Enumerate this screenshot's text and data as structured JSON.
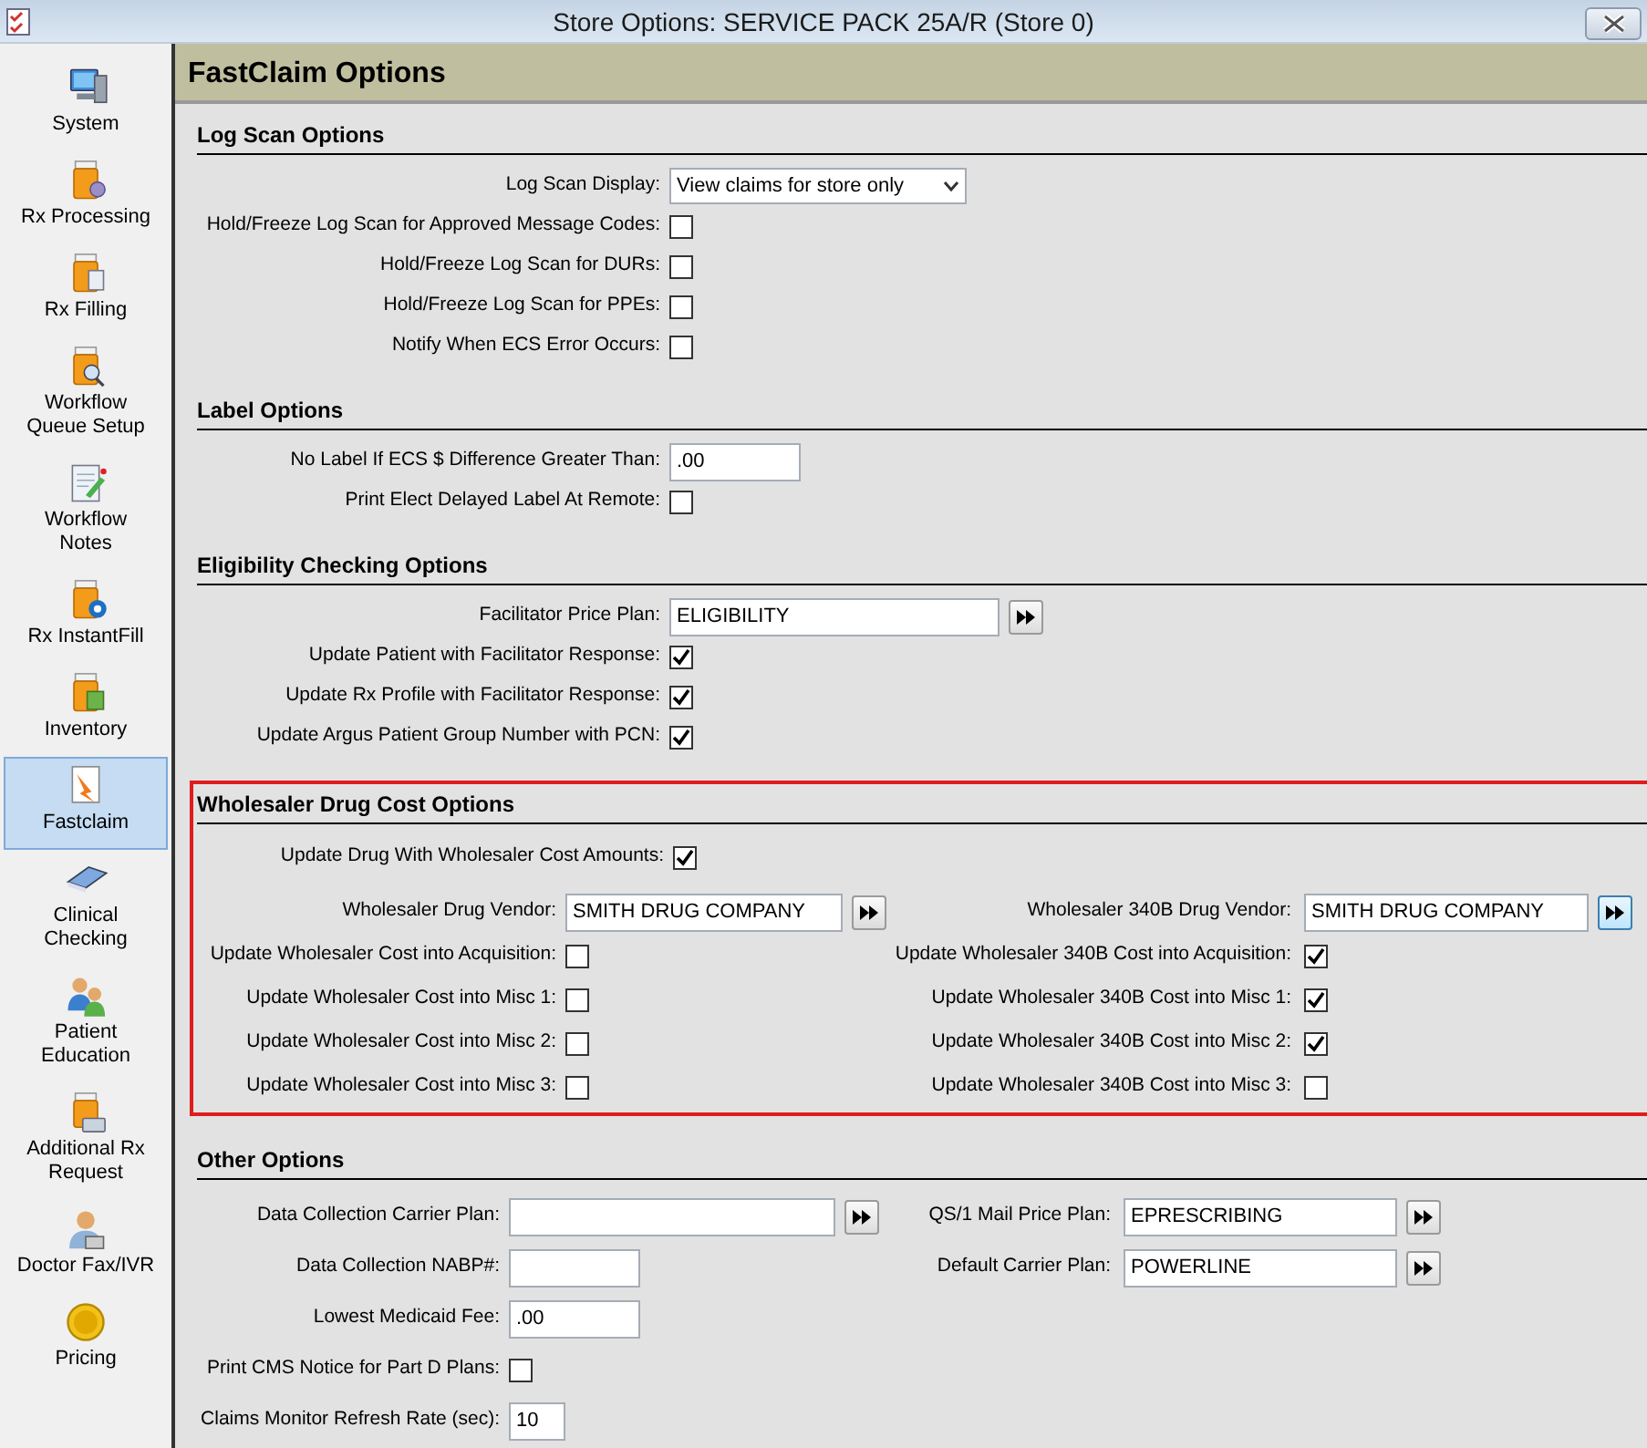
{
  "window": {
    "title": "Store Options: SERVICE PACK 25A/R (Store 0)"
  },
  "sidebar": {
    "items": [
      {
        "label": "System",
        "selected": false
      },
      {
        "label": "Rx Processing",
        "selected": false
      },
      {
        "label": "Rx Filling",
        "selected": false
      },
      {
        "label": "Workflow\nQueue Setup",
        "selected": false
      },
      {
        "label": "Workflow\nNotes",
        "selected": false
      },
      {
        "label": "Rx InstantFill",
        "selected": false
      },
      {
        "label": "Inventory",
        "selected": false
      },
      {
        "label": "Fastclaim",
        "selected": true
      },
      {
        "label": "Clinical\nChecking",
        "selected": false
      },
      {
        "label": "Patient\nEducation",
        "selected": false
      },
      {
        "label": "Additional Rx\nRequest",
        "selected": false
      },
      {
        "label": "Doctor Fax/IVR",
        "selected": false
      },
      {
        "label": "Pricing",
        "selected": false
      }
    ]
  },
  "page_title": "FastClaim Options",
  "sections": [
    {
      "title": "Log Scan Options",
      "highlighted": false,
      "rows": [
        [
          {
            "kind": "select",
            "label": "Log Scan Display:",
            "value": "View claims for store only"
          }
        ],
        [
          {
            "kind": "checkbox",
            "label": "Hold/Freeze Log Scan for Approved Message Codes:",
            "checked": false
          }
        ],
        [
          {
            "kind": "checkbox",
            "label": "Hold/Freeze Log Scan for DURs:",
            "checked": false
          }
        ],
        [
          {
            "kind": "checkbox",
            "label": "Hold/Freeze Log Scan for PPEs:",
            "checked": false
          }
        ],
        [
          {
            "kind": "checkbox",
            "label": "Notify When ECS Error Occurs:",
            "checked": false
          }
        ]
      ]
    },
    {
      "title": "Label Options",
      "highlighted": false,
      "rows": [
        [
          {
            "kind": "text",
            "label": "No Label If ECS $ Difference Greater Than:",
            "value": ".00"
          }
        ],
        [
          {
            "kind": "checkbox",
            "label": "Print Elect Delayed Label At Remote:",
            "checked": false
          }
        ]
      ]
    },
    {
      "title": "Eligibility Checking Options",
      "highlighted": false,
      "rows": [
        [
          {
            "kind": "lookup",
            "label": "Facilitator Price Plan:",
            "value": "ELIGIBILITY",
            "focused": false
          }
        ],
        [
          {
            "kind": "checkbox",
            "label": "Update Patient with Facilitator Response:",
            "checked": true
          }
        ],
        [
          {
            "kind": "checkbox",
            "label": "Update Rx Profile with Facilitator Response:",
            "checked": true
          }
        ],
        [
          {
            "kind": "checkbox",
            "label": "Update Argus Patient Group Number with PCN:",
            "checked": true
          }
        ]
      ]
    },
    {
      "title": "Wholesaler Drug Cost Options",
      "highlighted": true,
      "rows": [
        [
          {
            "kind": "checkbox",
            "label": "Update Drug With Wholesaler Cost Amounts:",
            "checked": true
          }
        ],
        [
          {
            "kind": "lookup",
            "label": "Wholesaler Drug Vendor:",
            "value": "SMITH DRUG COMPANY",
            "focused": false
          },
          {
            "kind": "lookup",
            "label": "Wholesaler 340B Drug Vendor:",
            "value": "SMITH DRUG COMPANY",
            "focused": true
          }
        ],
        [
          {
            "kind": "checkbox",
            "label": "Update Wholesaler Cost into Acquisition:",
            "checked": false
          },
          {
            "kind": "checkbox",
            "label": "Update Wholesaler 340B Cost into Acquisition:",
            "checked": true
          }
        ],
        [
          {
            "kind": "checkbox",
            "label": "Update Wholesaler Cost into Misc 1:",
            "checked": false
          },
          {
            "kind": "checkbox",
            "label": "Update Wholesaler 340B Cost into Misc 1:",
            "checked": true
          }
        ],
        [
          {
            "kind": "checkbox",
            "label": "Update Wholesaler Cost into Misc 2:",
            "checked": false
          },
          {
            "kind": "checkbox",
            "label": "Update Wholesaler 340B Cost into Misc 2:",
            "checked": true
          }
        ],
        [
          {
            "kind": "checkbox",
            "label": "Update Wholesaler Cost into Misc 3:",
            "checked": false
          },
          {
            "kind": "checkbox",
            "label": "Update Wholesaler 340B Cost into Misc 3:",
            "checked": false
          }
        ]
      ]
    },
    {
      "title": "Other Options",
      "highlighted": false,
      "rows": [
        [
          {
            "kind": "lookup",
            "label": "Data Collection Carrier Plan:",
            "focused": false
          },
          {
            "kind": "lookup",
            "label": "QS/1 Mail Price Plan:",
            "value": "EPRESCRIBING",
            "focused": false
          }
        ],
        [
          {
            "kind": "text",
            "label": "Data Collection NABP#:"
          },
          {
            "kind": "lookup",
            "label": "Default Carrier Plan:",
            "value": "POWERLINE",
            "focused": false
          }
        ],
        [
          {
            "kind": "text",
            "label": "Lowest Medicaid Fee:",
            "value": ".00"
          }
        ],
        [
          {
            "kind": "checkbox",
            "label": "Print CMS Notice for Part D Plans:",
            "checked": false
          }
        ],
        [
          {
            "kind": "text",
            "label": "Claims Monitor Refresh Rate (sec):",
            "value": "10"
          }
        ]
      ]
    }
  ]
}
